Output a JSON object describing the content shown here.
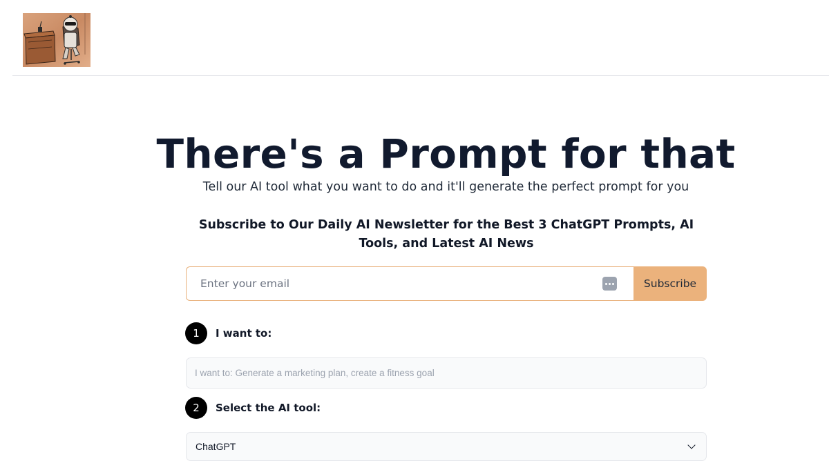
{
  "hero": {
    "title": "There's a Prompt for that",
    "subtitle": "Tell our AI tool what you want to do and it'll generate the perfect prompt for you"
  },
  "newsletter": {
    "heading": "Subscribe to Our Daily AI Newsletter for the Best 3 ChatGPT Prompts, AI Tools, and Latest AI News",
    "email_placeholder": "Enter your email",
    "subscribe_label": "Subscribe"
  },
  "steps": [
    {
      "number": "1",
      "label": "I want to:",
      "placeholder": "I want to: Generate a marketing plan, create a fitness goal"
    },
    {
      "number": "2",
      "label": "Select the AI tool:",
      "selected": "ChatGPT"
    }
  ],
  "colors": {
    "accent": "#ebb27c",
    "accent_border": "#e8b07a",
    "title": "#111a2e",
    "step_badge": "#000000"
  },
  "icons": {
    "logo": "robot-at-desk-logo",
    "password_manager": "password-manager-icon",
    "select_chevron": "chevron-down-icon"
  }
}
